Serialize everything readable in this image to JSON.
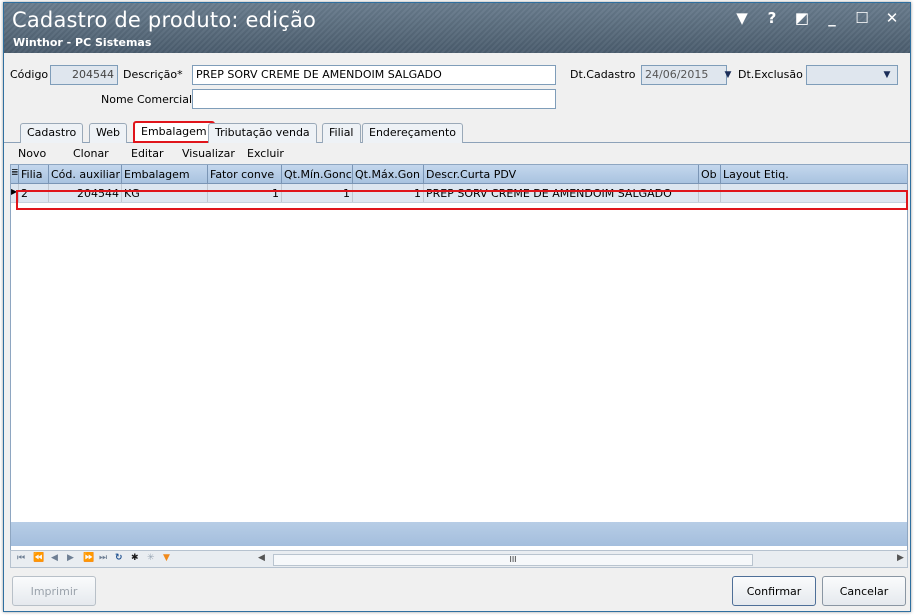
{
  "window": {
    "title": "Cadastro de produto: edição",
    "subtitle": "Winthor - PC Sistemas",
    "controls": [
      "▼",
      "?",
      "◩",
      "_",
      "☐",
      "✕"
    ]
  },
  "form": {
    "codigo_label": "Código",
    "codigo_value": "204544",
    "descricao_label": "Descrição*",
    "descricao_value": "PREP SORV CREME DE AMENDOIM SALGADO",
    "nome_comercial_label": "Nome Comercial",
    "nome_comercial_value": "",
    "dt_cadastro_label": "Dt.Cadastro",
    "dt_cadastro_value": "24/06/2015",
    "dt_exclusao_label": "Dt.Exclusão",
    "dt_exclusao_value": ""
  },
  "tabs": [
    "Cadastro",
    "Web",
    "Embalagem",
    "Tributação venda",
    "Filial",
    "Endereçamento"
  ],
  "active_tab": "Embalagem",
  "toolbar": {
    "novo": "Novo",
    "clonar": "Clonar",
    "editar": "Editar",
    "visualizar": "Visualizar",
    "excluir": "Excluir"
  },
  "grid": {
    "headers": [
      "Filia",
      "Cód. auxiliar",
      "Embalagem",
      "Fator conve",
      "Qt.Mín.Gonc",
      "Qt.Máx.Gon",
      "Descr.Curta PDV",
      "Ob",
      "Layout Etiq."
    ],
    "rows": [
      [
        "2",
        "204544",
        "KG",
        "1",
        "1",
        "1",
        "PREP SORV CREME DE AMENDOIM SALGADO",
        "",
        ""
      ]
    ]
  },
  "nav": {
    "scroll_thumb_label": "III"
  },
  "buttons": {
    "imprimir": "Imprimir",
    "confirmar": "Confirmar",
    "cancelar": "Cancelar"
  },
  "colors": {
    "highlight": "#e0151b",
    "titlebar": "#55687a",
    "grid_header": "#b4cbe6"
  }
}
